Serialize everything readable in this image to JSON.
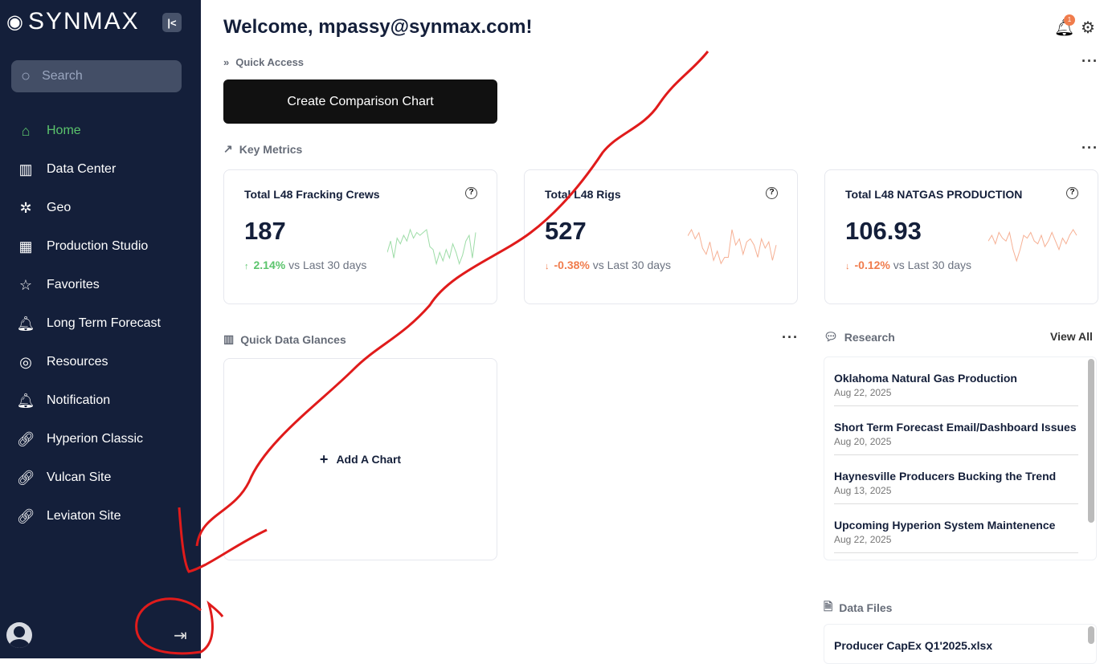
{
  "sidebar": {
    "brand": "SYNMAX",
    "search_placeholder": "Search",
    "items": [
      {
        "label": "Home",
        "icon": "home-icon",
        "glyph": "⌂"
      },
      {
        "label": "Data Center",
        "icon": "bar-chart-icon",
        "glyph": "▥"
      },
      {
        "label": "Geo",
        "icon": "atom-icon",
        "glyph": "✲"
      },
      {
        "label": "Production Studio",
        "icon": "grid-icon",
        "glyph": "▦"
      },
      {
        "label": "Favorites",
        "icon": "star-icon",
        "glyph": "☆"
      },
      {
        "label": "Long Term Forecast",
        "icon": "bell-icon",
        "glyph": "🔔︎"
      },
      {
        "label": "Resources",
        "icon": "lifebuoy-icon",
        "glyph": "◎"
      },
      {
        "label": "Notification",
        "icon": "bell-icon",
        "glyph": "🔔︎"
      },
      {
        "label": "Hyperion Classic",
        "icon": "link-icon",
        "glyph": "🔗︎"
      },
      {
        "label": "Vulcan Site",
        "icon": "link-icon",
        "glyph": "🔗︎"
      },
      {
        "label": "Leviaton Site",
        "icon": "link-icon",
        "glyph": "🔗︎"
      }
    ]
  },
  "header": {
    "welcome": "Welcome, mpassy@synmax.com!",
    "notification_count": "1"
  },
  "quick_access": {
    "title": "Quick Access",
    "button": "Create Comparison Chart"
  },
  "key_metrics": {
    "title": "Key Metrics",
    "cards": [
      {
        "title": "Total L48 Fracking Crews",
        "value": "187",
        "change": "2.14%",
        "direction": "up",
        "suffix": "vs Last 30 days",
        "color": "#5bc46c",
        "spark": [
          5,
          9,
          3,
          10,
          8,
          11,
          9,
          13,
          10,
          12,
          11,
          12,
          13,
          7,
          6,
          1,
          5,
          2,
          6,
          3,
          8,
          5,
          1,
          4,
          9,
          11,
          3,
          12
        ]
      },
      {
        "title": "Total L48 Rigs",
        "value": "527",
        "change": "-0.38%",
        "direction": "down",
        "suffix": "vs Last 30 days",
        "color": "#f07c4c",
        "spark": [
          10,
          12,
          9,
          11,
          6,
          4,
          8,
          2,
          5,
          1,
          3,
          3,
          12,
          7,
          9,
          4,
          8,
          9,
          7,
          3,
          9,
          6,
          8,
          2,
          7
        ]
      },
      {
        "title": "Total L48 NATGAS PRODUCTION",
        "value": "106.93",
        "change": "-0.12%",
        "direction": "down",
        "suffix": "vs Last 30 days",
        "color": "#f07c4c",
        "spark": [
          9,
          11,
          8,
          12,
          10,
          9,
          12,
          6,
          2,
          6,
          11,
          10,
          12,
          9,
          8,
          11,
          7,
          9,
          12,
          9,
          6,
          10,
          8,
          11,
          13,
          11
        ]
      }
    ]
  },
  "glances": {
    "title": "Quick Data Glances",
    "add": "Add A Chart"
  },
  "research": {
    "title": "Research",
    "view_all": "View All",
    "items": [
      {
        "title": "Oklahoma Natural Gas Production",
        "date": "Aug 22, 2025"
      },
      {
        "title": "Short Term Forecast Email/Dashboard Issues",
        "date": "Aug 20, 2025"
      },
      {
        "title": "Haynesville Producers Bucking the Trend",
        "date": "Aug 13, 2025"
      },
      {
        "title": "Upcoming Hyperion System Maintenence",
        "date": "Aug 22, 2025"
      }
    ]
  },
  "data_files": {
    "title": "Data Files",
    "items": [
      {
        "title": "Producer CapEx Q1'2025.xlsx"
      }
    ]
  }
}
